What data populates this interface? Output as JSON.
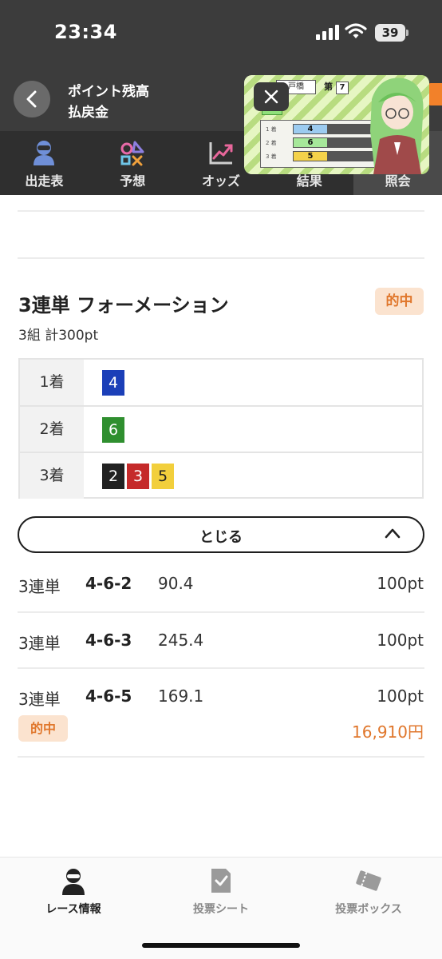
{
  "status_bar": {
    "time": "23:34",
    "battery": "39"
  },
  "header": {
    "line1": "ポイント残高",
    "line2": "払戻金"
  },
  "tabs": [
    {
      "label": "出走表",
      "icon": "jockey-icon"
    },
    {
      "label": "予想",
      "icon": "shapes-icon"
    },
    {
      "label": "オッズ",
      "icon": "chart-up-icon"
    },
    {
      "label": "結果",
      "icon": "trophy-icon"
    },
    {
      "label": "照会",
      "icon": "search-icon",
      "active": true
    }
  ],
  "overlay": {
    "venue": "戸橋",
    "race_prefix": "第",
    "race_num": "7",
    "status": "決定",
    "results": [
      "4",
      "6",
      "5"
    ],
    "rank_labels": [
      "1 着",
      "2 着",
      "3 着"
    ]
  },
  "ticket": {
    "title": "3連単 フォーメーション",
    "hit_label": "的中",
    "summary": "3組 計300pt",
    "rows": [
      {
        "label": "1着",
        "nums": [
          "4"
        ]
      },
      {
        "label": "2着",
        "nums": [
          "6"
        ]
      },
      {
        "label": "3着",
        "nums": [
          "2",
          "3",
          "5"
        ]
      }
    ],
    "num_colors": {
      "1": "#ffffff",
      "2": "#222222",
      "3": "#c52a2a",
      "4": "#1b3fb8",
      "5": "#f2cf3c",
      "6": "#2f8f2f"
    },
    "close_label": "とじる"
  },
  "bets": [
    {
      "type": "3連単",
      "combo": "4-6-2",
      "odds": "90.4",
      "amount": "100pt"
    },
    {
      "type": "3連単",
      "combo": "4-6-3",
      "odds": "245.4",
      "amount": "100pt"
    },
    {
      "type": "3連単",
      "combo": "4-6-5",
      "odds": "169.1",
      "amount": "100pt",
      "hit_label": "的中",
      "payout": "16,910円"
    }
  ],
  "bottom_nav": [
    {
      "label": "レース情報",
      "icon": "jockey-icon",
      "active": true
    },
    {
      "label": "投票シート",
      "icon": "checked-sheet-icon"
    },
    {
      "label": "投票ボックス",
      "icon": "ticket-icon"
    }
  ],
  "colors": {
    "accent_orange": "#e0772c",
    "hit_bg": "#fbe3cf",
    "header_bg": "#3c3c3c"
  }
}
